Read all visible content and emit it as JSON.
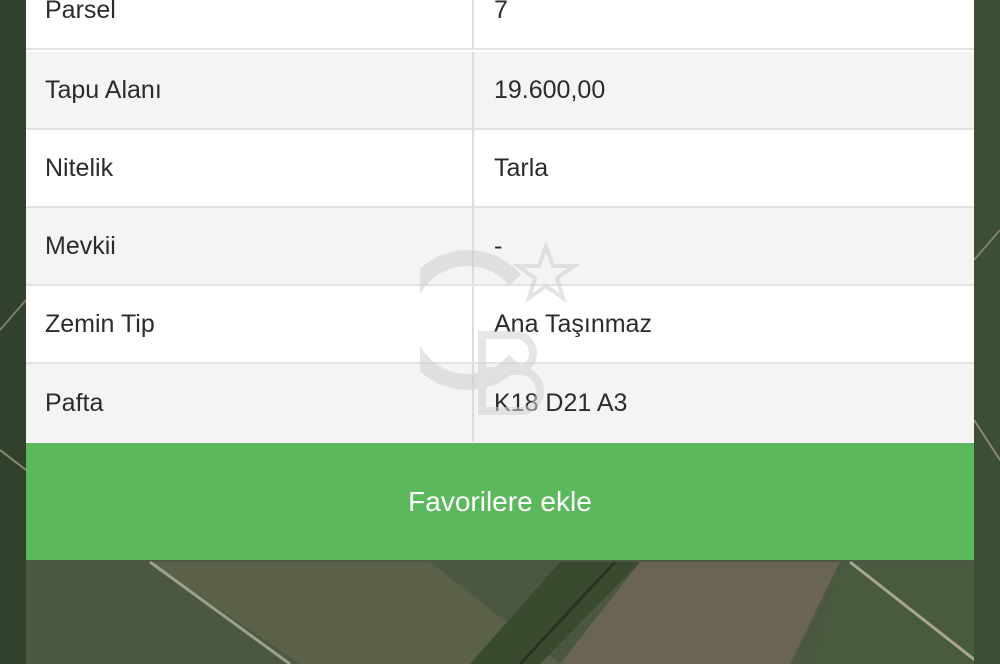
{
  "table": {
    "rows": [
      {
        "label": "Parsel",
        "value": "7"
      },
      {
        "label": "Tapu Alanı",
        "value": "19.600,00"
      },
      {
        "label": "Nitelik",
        "value": "Tarla"
      },
      {
        "label": "Mevkii",
        "value": "-"
      },
      {
        "label": "Zemin Tip",
        "value": "Ana Taşınmaz"
      },
      {
        "label": "Pafta",
        "value": "K18 D21 A3"
      }
    ]
  },
  "actions": {
    "favorite_label": "Favorilere ekle"
  },
  "colors": {
    "favorite_button": "#5cb85c",
    "row_alt": "#f4f4f4",
    "row_plain": "#ffffff"
  }
}
